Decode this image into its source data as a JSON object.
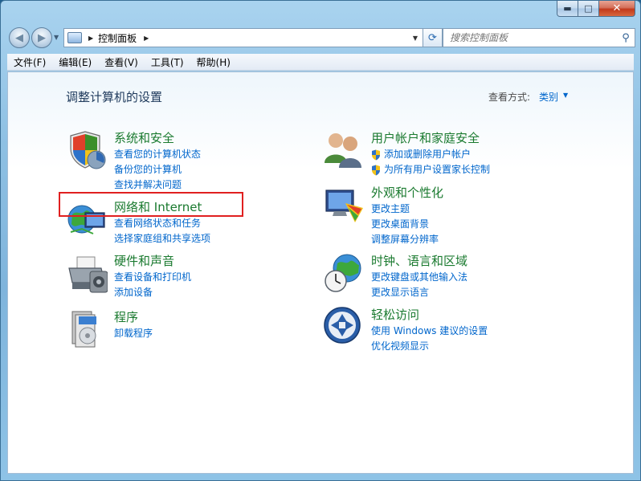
{
  "window": {
    "caption": {
      "minimize": "▬",
      "maximize": "□",
      "close": "✕"
    }
  },
  "address_bar": {
    "path": "控制面板",
    "search_placeholder": "搜索控制面板"
  },
  "menu": [
    "文件(F)",
    "编辑(E)",
    "查看(V)",
    "工具(T)",
    "帮助(H)"
  ],
  "content": {
    "title": "调整计算机的设置",
    "view_by_label": "查看方式:",
    "view_by_value": "类别"
  },
  "categories": [
    {
      "title": "系统和安全",
      "links": [
        "查看您的计算机状态",
        "备份您的计算机",
        "查找并解决问题"
      ],
      "icon": "security-shield-icon"
    },
    {
      "title": "网络和 Internet",
      "links": [
        "查看网络状态和任务",
        "选择家庭组和共享选项"
      ],
      "icon": "network-globe-icon"
    },
    {
      "title": "硬件和声音",
      "links": [
        "查看设备和打印机",
        "添加设备"
      ],
      "icon": "printer-icon"
    },
    {
      "title": "程序",
      "links": [
        "卸载程序"
      ],
      "icon": "programs-icon"
    },
    {
      "title": "用户帐户和家庭安全",
      "links": [
        "添加或删除用户帐户",
        "为所有用户设置家长控制"
      ],
      "icon": "users-icon"
    },
    {
      "title": "外观和个性化",
      "links": [
        "更改主题",
        "更改桌面背景",
        "调整屏幕分辨率"
      ],
      "icon": "monitor-paint-icon"
    },
    {
      "title": "时钟、语言和区域",
      "links": [
        "更改键盘或其他输入法",
        "更改显示语言"
      ],
      "icon": "clock-globe-icon"
    },
    {
      "title": "轻松访问",
      "links": [
        "使用 Windows 建议的设置",
        "优化视频显示"
      ],
      "icon": "ease-of-access-icon"
    }
  ],
  "colors": {
    "category_title": "#1a7a2f",
    "link": "#0066cc",
    "highlight_box": "#e02020"
  }
}
